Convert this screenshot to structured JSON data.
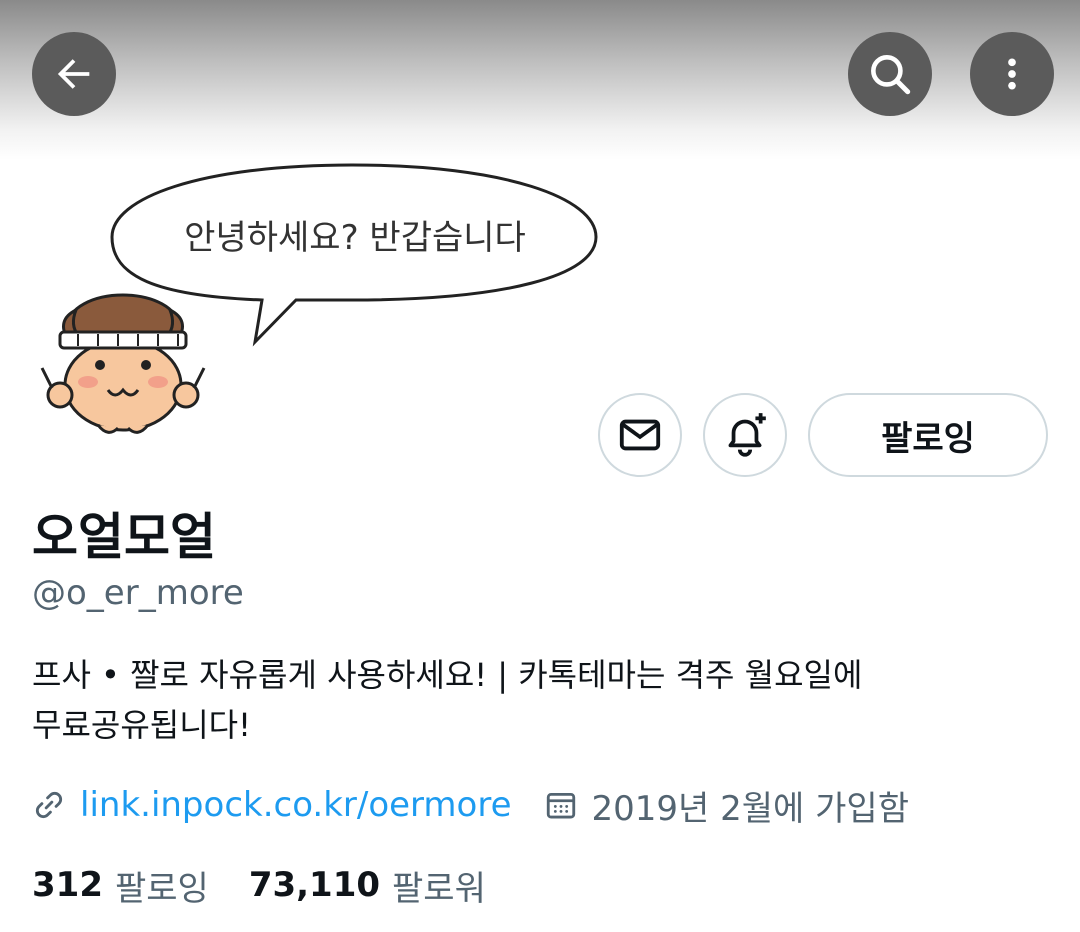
{
  "header": {
    "back_icon": "arrow-left-icon",
    "search_icon": "search-icon",
    "more_icon": "more-vertical-icon"
  },
  "banner": {
    "speech_bubble_text": "안녕하세요? 반갑습니다"
  },
  "actions": {
    "message_icon": "envelope-icon",
    "notify_icon": "bell-plus-icon",
    "follow_label": "팔로잉"
  },
  "profile": {
    "display_name": "오얼모얼",
    "handle": "@o_er_more",
    "bio_line1": "프사 • 짤로 자유롭게 사용하세요! | 카톡테마는 격주 월요일에",
    "bio_line2": "무료공유됩니다!",
    "link": "link.inpock.co.kr/oermore",
    "joined": "2019년 2월에 가입함"
  },
  "stats": {
    "following_count": "312",
    "following_label": "팔로잉",
    "followers_count": "73,110",
    "followers_label": "팔로워"
  },
  "colors": {
    "link": "#1d9bf0",
    "secondary_text": "#536471",
    "primary_text": "#0f1419",
    "border": "#cfd9de"
  }
}
